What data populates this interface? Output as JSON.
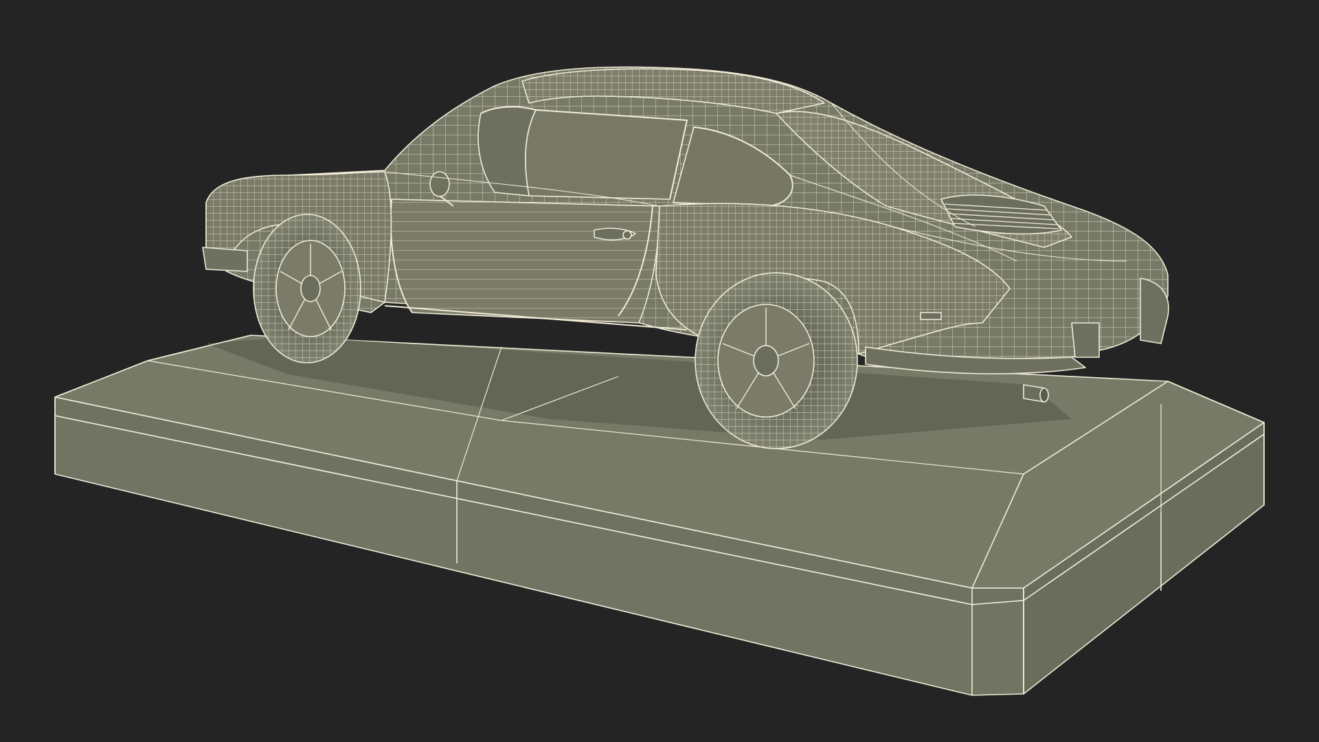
{
  "scene": {
    "subject": "",
    "colors": {
      "background": "#242424",
      "model_fill": "#767866",
      "model_fill_dark": "#5f6152",
      "model_fill_light": "#888a77",
      "wireframe": "#f1ecd8",
      "shadow": "#4a4c40"
    }
  }
}
